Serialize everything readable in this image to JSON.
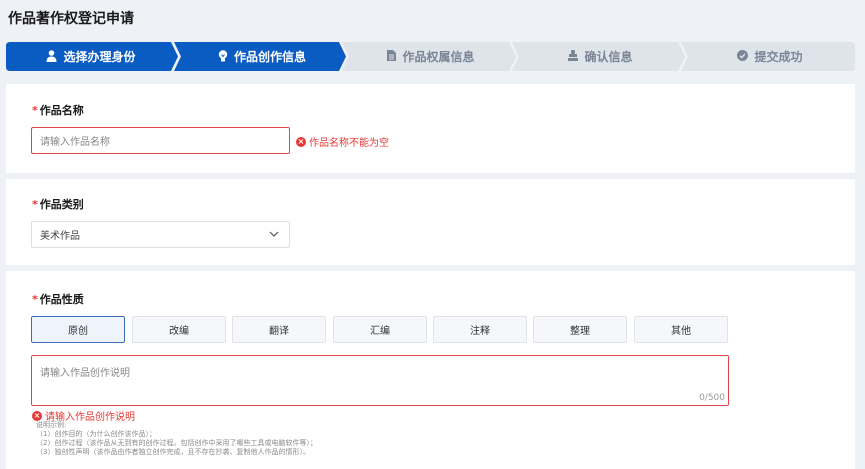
{
  "page": {
    "title": "作品著作权登记申请"
  },
  "steps": [
    {
      "label": "选择办理身份",
      "icon": "user-icon",
      "state": "done"
    },
    {
      "label": "作品创作信息",
      "icon": "bulb-icon",
      "state": "active"
    },
    {
      "label": "作品权属信息",
      "icon": "document-icon",
      "state": "pending"
    },
    {
      "label": "确认信息",
      "icon": "stamp-icon",
      "state": "pending"
    },
    {
      "label": "提交成功",
      "icon": "check-circle-icon",
      "state": "pending"
    }
  ],
  "colors": {
    "accent": "#0a5cc2",
    "inactive": "#dfe4ea",
    "error": "#e53935"
  },
  "work_name": {
    "required_mark": "*",
    "label": "作品名称",
    "placeholder": "请输入作品名称",
    "error": "作品名称不能为空"
  },
  "work_category": {
    "required_mark": "*",
    "label": "作品类别",
    "selected": "美术作品"
  },
  "work_nature": {
    "required_mark": "*",
    "label": "作品性质",
    "options": [
      "原创",
      "改编",
      "翻译",
      "汇编",
      "注释",
      "整理",
      "其他"
    ],
    "selected": "原创",
    "placeholder": "请输入作品创作说明",
    "counter": "0/500",
    "error": "请输入作品创作说明",
    "hints": [
      "说明示例:",
      "（1）创作目的（为什么创作该作品）；",
      "（2）创作过程（该作品从无到有的创作过程。包括创作中采用了哪些工具或电脑软件等）；",
      "（3）独创性声明（该作品由作者独立创作完成，且不存在抄袭、复制他人作品的情形）。"
    ]
  }
}
